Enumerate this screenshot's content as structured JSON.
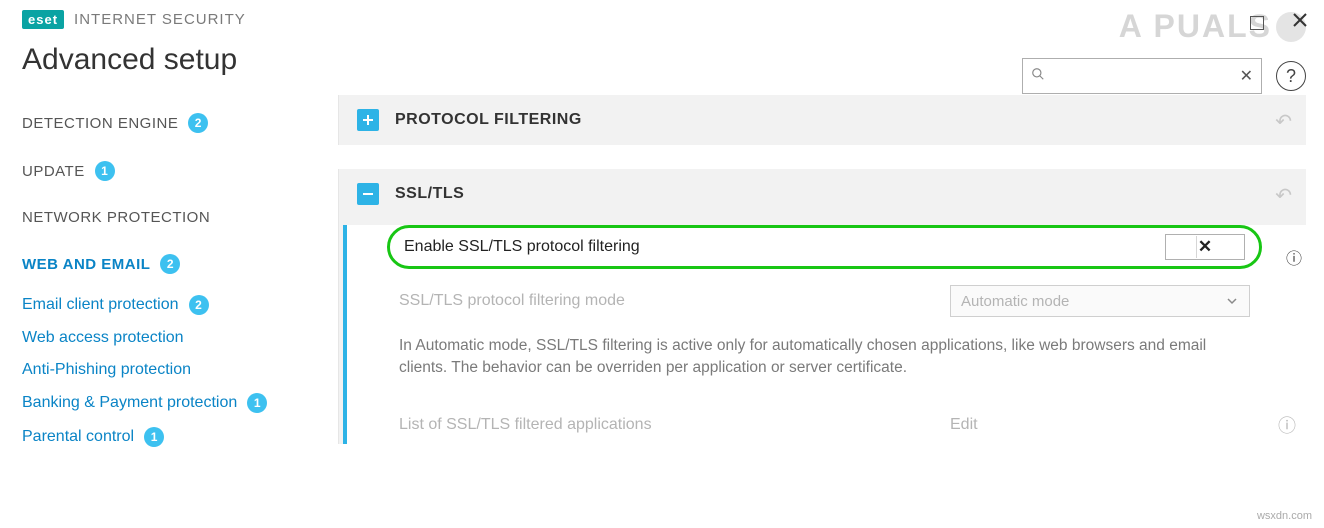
{
  "brand": {
    "logo": "eset",
    "product": "INTERNET SECURITY"
  },
  "page_title": "Advanced setup",
  "search": {
    "value": "",
    "placeholder": ""
  },
  "sidebar": {
    "items": [
      {
        "label": "DETECTION ENGINE",
        "badge": "2"
      },
      {
        "label": "UPDATE",
        "badge": "1"
      },
      {
        "label": "NETWORK PROTECTION",
        "badge": ""
      },
      {
        "label": "WEB AND EMAIL",
        "badge": "2",
        "active": true
      }
    ],
    "sub": [
      {
        "label": "Email client protection",
        "badge": "2"
      },
      {
        "label": "Web access protection",
        "badge": ""
      },
      {
        "label": "Anti-Phishing protection",
        "badge": ""
      },
      {
        "label": "Banking & Payment protection",
        "badge": "1"
      },
      {
        "label": "Parental control",
        "badge": "1"
      }
    ]
  },
  "sections": {
    "protocol": {
      "title": "PROTOCOL FILTERING"
    },
    "ssl": {
      "title": "SSL/TLS",
      "enable_label": "Enable SSL/TLS protocol filtering",
      "enable_state_icon": "x",
      "mode_label": "SSL/TLS protocol filtering mode",
      "mode_value": "Automatic mode",
      "description": "In Automatic mode, SSL/TLS filtering is active only for automatically chosen applications, like web browsers and email clients. The behavior can be overriden per application or server certificate.",
      "list_label": "List of SSL/TLS filtered applications",
      "list_action": "Edit"
    }
  },
  "watermark": "A  PUALS",
  "source_note": "wsxdn.com"
}
